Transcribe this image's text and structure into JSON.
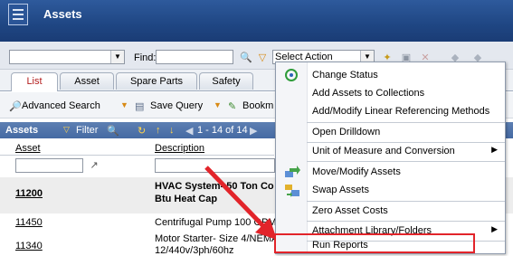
{
  "title": "Assets",
  "toolbar": {
    "find_label": "Find:",
    "find_value": "",
    "first_select_value": "",
    "action_select_value": "Select Action"
  },
  "tabs": [
    "List",
    "Asset",
    "Spare Parts",
    "Safety"
  ],
  "query_bar": {
    "advanced_search": "Advanced Search",
    "save_query": "Save Query",
    "bookmark": "Bookm"
  },
  "grid": {
    "title": "Assets",
    "filter": "Filter",
    "pager": "1 - 14 of 14",
    "columns": [
      "Asset",
      "Description"
    ],
    "rows": [
      {
        "asset": "11200",
        "description_line1": "HVAC System- 50 Ton Co",
        "description_line2": "Btu Heat Cap"
      },
      {
        "asset": "11450",
        "description_line1": "Centrifugal Pump 100 GPM/6",
        "description_line2": ""
      },
      {
        "asset": "11340",
        "description_line1": "Motor Starter- Size 4/NEMA",
        "description_line2": "12/440v/3ph/60hz"
      }
    ]
  },
  "menu": {
    "items": [
      {
        "label": "Change Status",
        "icon": "change-status-icon",
        "submenu": false
      },
      {
        "label": "Add Assets to Collections",
        "icon": "",
        "submenu": false
      },
      {
        "label": "Add/Modify Linear Referencing Methods",
        "icon": "",
        "submenu": false
      },
      {
        "label": "Open Drilldown",
        "icon": "",
        "submenu": false
      },
      {
        "label": "Unit of Measure and Conversion",
        "icon": "",
        "submenu": true
      },
      {
        "label": "Move/Modify Assets",
        "icon": "move-assets-icon",
        "submenu": false
      },
      {
        "label": "Swap Assets",
        "icon": "swap-assets-icon",
        "submenu": false
      },
      {
        "label": "Zero Asset Costs",
        "icon": "",
        "submenu": false
      },
      {
        "label": "Attachment Library/Folders",
        "icon": "",
        "submenu": true
      },
      {
        "label": "Run Reports",
        "icon": "",
        "submenu": false
      }
    ]
  },
  "colors": {
    "highlight": "#e2242a",
    "title_bar": "#1f4683",
    "active_tab_text": "#b31b1b"
  }
}
